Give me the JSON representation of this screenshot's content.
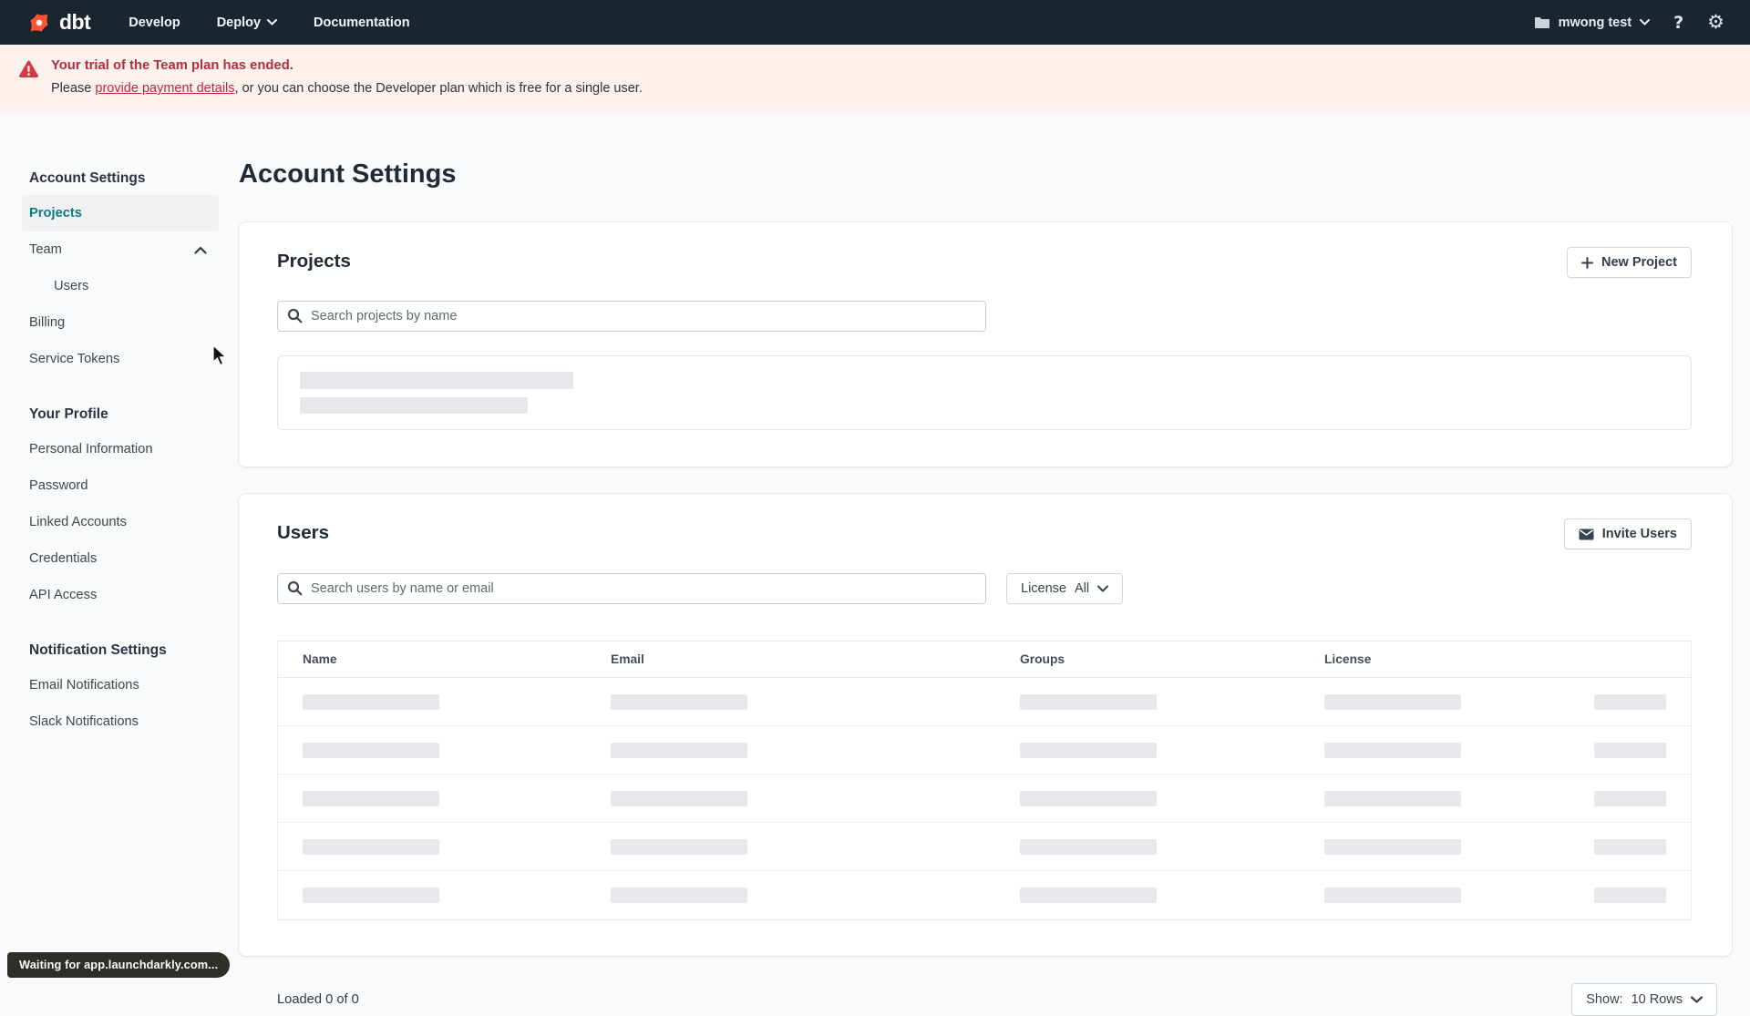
{
  "navbar": {
    "logo_text": "dbt",
    "menu": [
      {
        "label": "Develop"
      },
      {
        "label": "Deploy",
        "has_chevron": true
      },
      {
        "label": "Documentation"
      }
    ],
    "workspace": "mwong test",
    "help_glyph": "?",
    "gear_glyph": "⚙"
  },
  "banner": {
    "title": "Your trial of the Team plan has ended.",
    "body_prefix": "Please ",
    "payment_link": "provide payment details",
    "body_suffix": ", or you can choose the Developer plan which is free for a single user."
  },
  "sidebar": {
    "sections": [
      {
        "heading": "Account Settings",
        "items": [
          {
            "label": "Projects"
          },
          {
            "label": "Team"
          },
          {
            "label": "Users"
          },
          {
            "label": "Billing"
          },
          {
            "label": "Service Tokens"
          }
        ]
      },
      {
        "heading": "Your Profile",
        "items": [
          {
            "label": "Personal Information"
          },
          {
            "label": "Password"
          },
          {
            "label": "Linked Accounts"
          },
          {
            "label": "Credentials"
          },
          {
            "label": "API Access"
          }
        ]
      },
      {
        "heading": "Notification Settings",
        "items": [
          {
            "label": "Email Notifications"
          },
          {
            "label": "Slack Notifications"
          }
        ]
      }
    ]
  },
  "main": {
    "page_title": "Account Settings",
    "projects_card": {
      "title": "Projects",
      "new_project_button": "New Project",
      "search_placeholder": "Search projects by name"
    },
    "users_card": {
      "title": "Users",
      "invite_button": "Invite Users",
      "search_placeholder": "Search users by name or email",
      "license_filter": {
        "label": "License",
        "value": "All"
      },
      "table": {
        "headers": [
          "Name",
          "Email",
          "Groups",
          "License"
        ]
      }
    },
    "footer": {
      "loaded_text": "Loaded 0 of 0",
      "show_label": "Show:",
      "show_value": "10 Rows"
    }
  },
  "status_bubble": {
    "text": "Waiting for app.launchdarkly.com..."
  },
  "colors": {
    "navbar_bg": "#1b2530",
    "brand_orange": "#ff5436",
    "accent_teal": "#0e7d82",
    "danger_red": "#b42e3f",
    "banner_bg": "#fdf1ee",
    "skeleton_gray": "#e5e7ea"
  }
}
